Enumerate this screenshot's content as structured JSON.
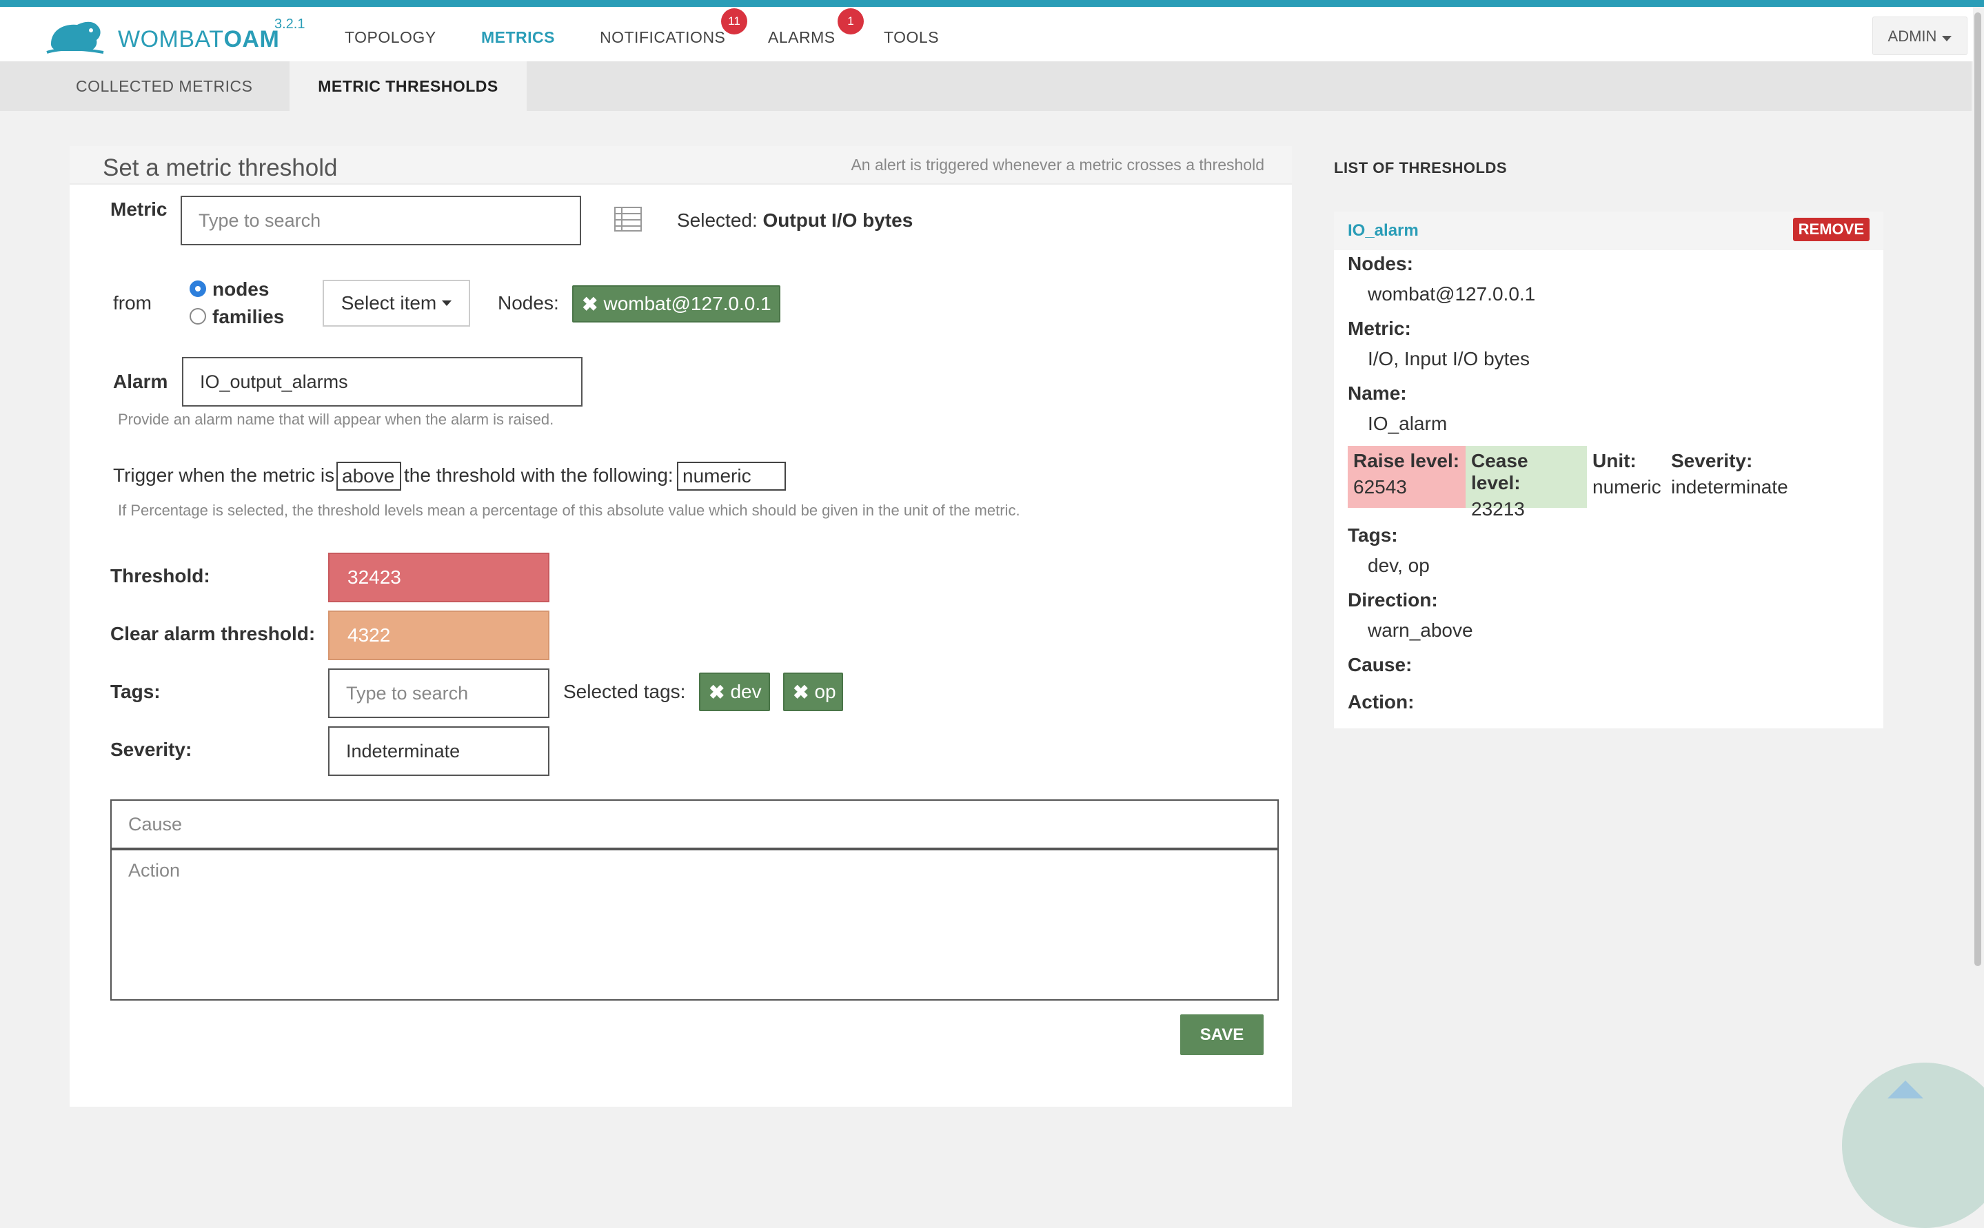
{
  "app": {
    "brand_light": "WOMBAT",
    "brand_bold": "OAM",
    "version": "3.2.1"
  },
  "nav": {
    "topology": "TOPOLOGY",
    "metrics": "METRICS",
    "notifications": "NOTIFICATIONS",
    "notifications_count": "11",
    "alarms": "ALARMS",
    "alarms_count": "1",
    "tools": "TOOLS",
    "admin": "ADMIN"
  },
  "subnav": {
    "collected": "COLLECTED METRICS",
    "thresholds": "METRIC THRESHOLDS"
  },
  "form": {
    "title": "Set a metric threshold",
    "hint": "An alert is triggered whenever a metric crosses a threshold",
    "metric_label": "Metric",
    "metric_placeholder": "Type to search",
    "selected_label": "Selected:",
    "selected_value": "Output I/O bytes",
    "from_label": "from",
    "radio_nodes": "nodes",
    "radio_families": "families",
    "select_item": "Select item",
    "nodes_label": "Nodes:",
    "node_chip": "wombat@127.0.0.1",
    "alarm_label": "Alarm",
    "alarm_value": "IO_output_alarms",
    "alarm_help": "Provide an alarm name that will appear when the alarm is raised.",
    "trigger_prefix": "Trigger when the metric is",
    "trigger_direction": "above",
    "trigger_middle": "the threshold with the following:",
    "trigger_unit": "numeric",
    "trigger_help": "If Percentage is selected, the threshold levels mean a percentage of this absolute value which should be given in the unit of the metric.",
    "threshold_label": "Threshold:",
    "threshold_value": "32423",
    "clear_label": "Clear alarm threshold:",
    "clear_value": "4322",
    "tags_label": "Tags:",
    "tags_placeholder": "Type to search",
    "selected_tags_label": "Selected tags:",
    "tag_1": "dev",
    "tag_2": "op",
    "severity_label": "Severity:",
    "severity_value": "Indeterminate",
    "cause_placeholder": "Cause",
    "action_placeholder": "Action",
    "save": "SAVE"
  },
  "list": {
    "title": "LIST OF THRESHOLDS",
    "item": {
      "name": "IO_alarm",
      "remove": "REMOVE",
      "nodes_label": "Nodes:",
      "nodes_value": "wombat@127.0.0.1",
      "metric_label": "Metric:",
      "metric_value": "I/O, Input I/O bytes",
      "name_label": "Name:",
      "name_value": "IO_alarm",
      "raise_label": "Raise level:",
      "raise_value": "62543",
      "cease_label": "Cease level:",
      "cease_value": "23213",
      "unit_label": "Unit:",
      "unit_value": "numeric",
      "severity_label": "Severity:",
      "severity_value": "indeterminate",
      "tags_label": "Tags:",
      "tags_value": "dev, op",
      "direction_label": "Direction:",
      "direction_value": "warn_above",
      "cause_label": "Cause:",
      "action_label": "Action:"
    }
  },
  "colors": {
    "accent": "#2a9db7",
    "threshold": "#dc6e72",
    "clear_threshold": "#e9ab84",
    "chip": "#5d8a5a",
    "badge": "#d9333f",
    "raise_bg": "#f7b9ba",
    "cease_bg": "#d6ead0"
  }
}
